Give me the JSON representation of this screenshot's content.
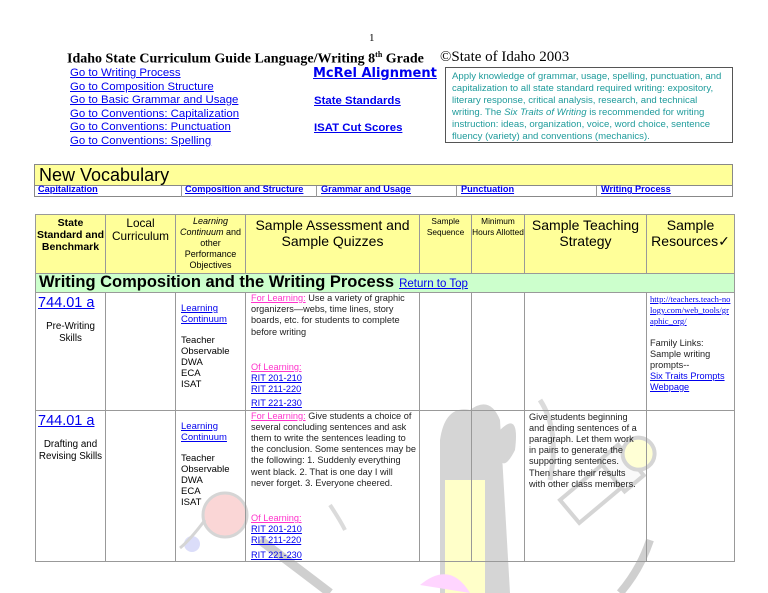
{
  "page_number": "1",
  "header": {
    "title_pre": "Idaho State Curriculum Guide Language/Writing 8",
    "title_sup": "th",
    "title_post": " Grade",
    "copyright": "©State of Idaho 2003"
  },
  "nav_links": [
    "Go to Writing Process",
    "Go to Composition Structure",
    "Go to Basic Grammar and Usage",
    "Go to Conventions: Capitalization",
    "Go to Conventions: Punctuation",
    "Go to Conventions: Spelling"
  ],
  "side_links": {
    "mcrel": "McRel Alignment",
    "state_standards": "State Standards",
    "isat": "ISAT Cut Scores"
  },
  "standard_box": {
    "text_1": "Apply knowledge of grammar, usage, spelling, punctuation, and capitalization to all state standard required writing: expository, literary response, critical analysis, research, and technical writing. The ",
    "text_italic": "Six Traits of Writing",
    "text_2": " is recommended for writing instruction: ideas, organization, voice, word choice, sentence fluency (variety) and conventions (mechanics)."
  },
  "vocabulary": {
    "title": "New Vocabulary",
    "links": [
      "Capitalization",
      "Composition and Structure",
      "Grammar and Usage",
      "Punctuation",
      "Writing Process"
    ]
  },
  "table": {
    "headers": {
      "standard": "State Standard and Benchmark",
      "local": "Local Curriculum",
      "lc_italic": "Learning Continuum",
      "lc_rest": "and other Performance Objectives",
      "assessment": "Sample Assessment and Sample Quizzes",
      "sequence": "Sample Sequence",
      "hours": "Minimum Hours Allotted",
      "strategy": "Sample Teaching Strategy",
      "resources": "Sample Resources",
      "resources_mark": "✓"
    },
    "section": {
      "title": "Writing Composition and the Writing Process",
      "return_link": "Return to Top"
    },
    "rows": [
      {
        "standard": "744.01 a",
        "skill": "Pre-Writing Skills",
        "lc_link": "Learning Continuum",
        "lc_items": [
          "Teacher",
          "Observable",
          "DWA",
          "ECA",
          "ISAT"
        ],
        "for_label": "For Learning:",
        "for_text": " Use a variety of graphic organizers—webs, time lines, story boards, etc.  for students to complete before writing",
        "of_label": "Of Learning:",
        "rit_links": [
          "RIT 201-210",
          "RIT 211-220",
          "RIT 221-230"
        ],
        "strategy": "",
        "resource_url": "http://teachers.teach-nology.com/web_tools/graphic_org/",
        "family_text": "Family Links: Sample writing prompts--",
        "family_link": "Six Traits Prompts Webpage"
      },
      {
        "standard": "744.01 a",
        "skill": "Drafting and Revising Skills",
        "lc_link": "Learning Continuum",
        "lc_items": [
          "Teacher",
          "Observable",
          "DWA",
          "ECA",
          "ISAT"
        ],
        "for_label": "For Learning:",
        "for_text": " Give students a choice of several concluding sentences and ask them to write the sentences leading to the conclusion.  Some sentences may be the following:  1. Suddenly everything went black.  2.  That is one day I will never forget.  3.  Everyone cheered.",
        "of_label": "Of Learning:",
        "rit_links": [
          "RIT 201-210",
          "RIT 211-220",
          "RIT 221-230"
        ],
        "strategy": "Give students beginning and ending sentences of a paragraph.  Let them work in pairs to generate the supporting sentences.  Then share their results with other class members."
      }
    ]
  },
  "colors": {
    "header_yellow": "#ffff99",
    "section_green": "#ccffcc",
    "link_blue": "#0000ee",
    "pink_label": "#ff33cc",
    "standard_teal": "#1f9b9b"
  }
}
